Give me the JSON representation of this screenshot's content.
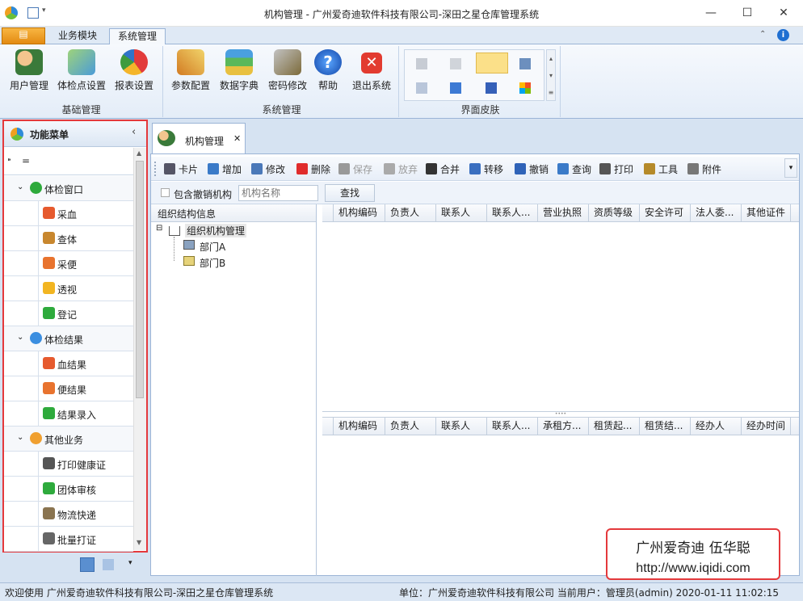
{
  "window": {
    "title": "机构管理 - 广州爱奇迪软件科技有限公司-深田之星仓库管理系统"
  },
  "ribbon": {
    "tabs": [
      "业务模块",
      "系统管理"
    ],
    "groups": [
      {
        "caption": "基础管理",
        "buttons": [
          "用户管理",
          "体检点设置",
          "报表设置"
        ]
      },
      {
        "caption": "系统管理",
        "buttons": [
          "参数配置",
          "数据字典",
          "密码修改",
          "帮助",
          "退出系统"
        ]
      },
      {
        "caption": "界面皮肤"
      }
    ]
  },
  "left_panel": {
    "title": "功能菜单",
    "filter_value": "=",
    "groups": [
      {
        "label": "体检窗口",
        "items": [
          "采血",
          "查体",
          "采便",
          "透视",
          "登记"
        ]
      },
      {
        "label": "体检结果",
        "items": [
          "血结果",
          "便结果",
          "结果录入"
        ]
      },
      {
        "label": "其他业务",
        "items": [
          "打印健康证",
          "团体审核",
          "物流快递",
          "批量打证"
        ]
      }
    ]
  },
  "doc_tab": {
    "label": "机构管理"
  },
  "toolbar": {
    "buttons": [
      "卡片",
      "增加",
      "修改",
      "删除",
      "保存",
      "放弃",
      "合并",
      "转移",
      "撤销",
      "查询",
      "打印",
      "工具",
      "附件"
    ]
  },
  "filter": {
    "checkbox_label": "包含撤销机构",
    "search_placeholder": "机构名称",
    "search_button": "查找"
  },
  "org_tree": {
    "header": "组织结构信息",
    "root": "组织机构管理",
    "children": [
      "部门A",
      "部门B"
    ]
  },
  "top_grid": {
    "columns": [
      "机构编码",
      "负责人",
      "联系人",
      "联系人...",
      "营业执照",
      "资质等级",
      "安全许可",
      "法人委...",
      "其他证件"
    ]
  },
  "bottom_grid": {
    "columns": [
      "机构编码",
      "负责人",
      "联系人",
      "联系人...",
      "承租方...",
      "租赁起...",
      "租赁结...",
      "经办人",
      "经办时间"
    ]
  },
  "status_bar": {
    "welcome": "欢迎使用 广州爱奇迪软件科技有限公司-深田之星仓库管理系统",
    "unit": "单位：广州爱奇迪软件科技有限公司 当前用户：管理员(admin)  2020-01-11 11:02:15"
  },
  "watermark": {
    "line1": "广州爱奇迪  伍华聪",
    "line2": "http://www.iqidi.com"
  }
}
